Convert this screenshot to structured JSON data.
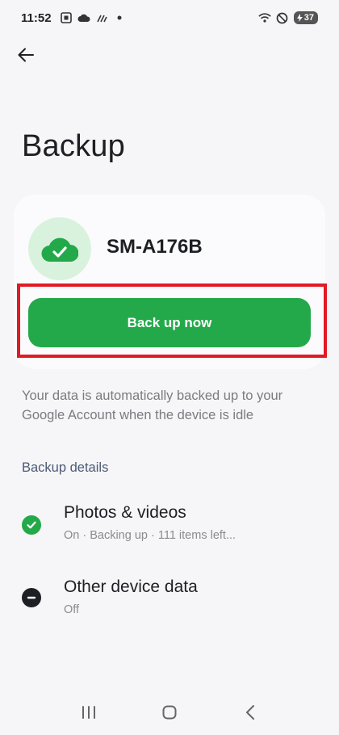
{
  "status_bar": {
    "time": "11:52",
    "battery": "37"
  },
  "header": {
    "title": "Backup"
  },
  "card": {
    "device_name": "SM-A176B",
    "button_label": "Back up now"
  },
  "description": "Your data is automatically backed up to your Google Account when the device is idle",
  "section": {
    "title": "Backup details",
    "items": [
      {
        "title": "Photos & videos",
        "subtitle": "On · Backing up · 111 items left...",
        "status_icon": "check-circle-icon",
        "status_color": "#23a94a"
      },
      {
        "title": "Other device data",
        "subtitle": "Off",
        "status_icon": "minus-circle-icon",
        "status_color": "#1e1f24"
      }
    ]
  },
  "colors": {
    "accent_green": "#23a94a",
    "avatar_bg": "#d9f2de",
    "highlight_red": "#e01b24"
  }
}
